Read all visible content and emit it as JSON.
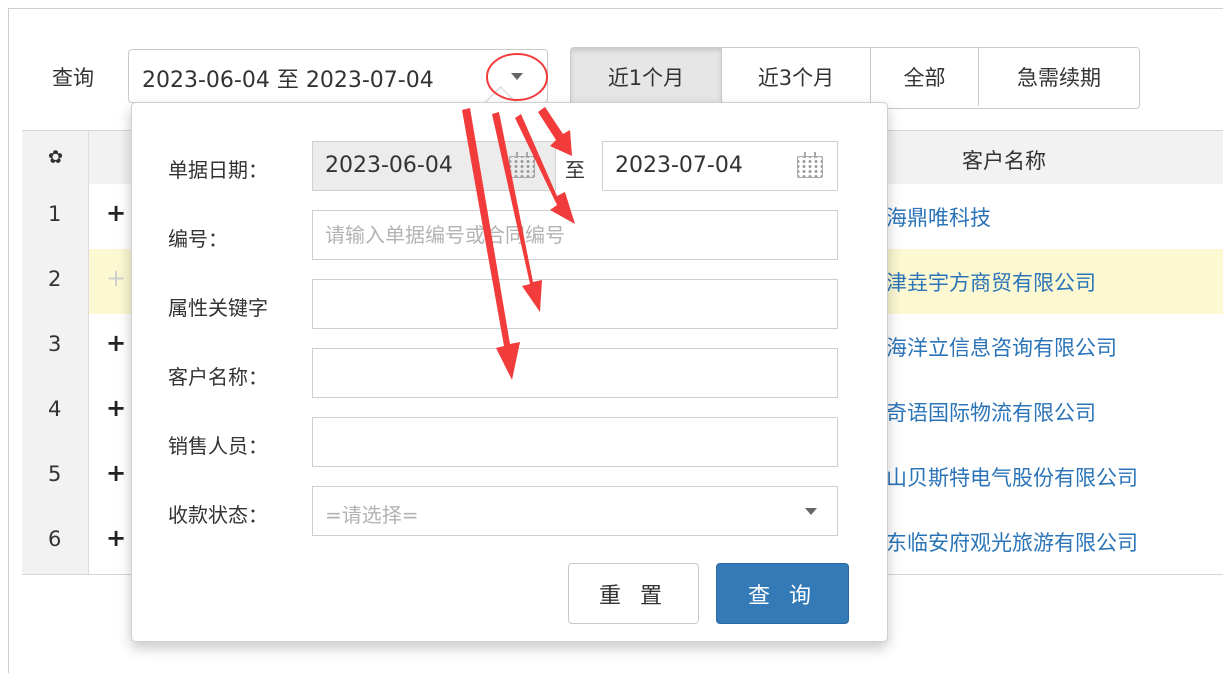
{
  "toolbar": {
    "query_label": "查询",
    "date_range": "2023-06-04 至 2023-07-04",
    "quick_ranges": [
      "近1个月",
      "近3个月",
      "全部",
      "急需续期"
    ],
    "active_quick_range": "近1个月"
  },
  "table": {
    "columns": {
      "customer": "客户名称"
    },
    "icons": {
      "settings": "gear-icon",
      "expand": "plus-icon"
    },
    "rows": [
      {
        "num": "1",
        "expand": "+",
        "customer": "海鼎唯科技"
      },
      {
        "num": "2",
        "expand": "+",
        "customer": "津垚宇方商贸有限公司"
      },
      {
        "num": "3",
        "expand": "+",
        "customer": "海洋立信息咨询有限公司"
      },
      {
        "num": "4",
        "expand": "+",
        "customer": "奇语国际物流有限公司"
      },
      {
        "num": "5",
        "expand": "+",
        "customer": "山贝斯特电气股份有限公司"
      },
      {
        "num": "6",
        "expand": "+",
        "customer": "东临安府观光旅游有限公司"
      }
    ]
  },
  "filter_popover": {
    "date_label": "单据日期：",
    "date_start": "2023-06-04",
    "date_sep": "至",
    "date_end": "2023-07-04",
    "number_label": "编号：",
    "number_placeholder": "请输入单据编号或合同编号",
    "number_value": "",
    "keyword_label": "属性关键字",
    "keyword_value": "",
    "customer_label": "客户名称：",
    "customer_value": "",
    "sales_label": "销售人员：",
    "sales_value": "",
    "status_label": "收款状态：",
    "status_selected": "=请选择=",
    "reset_label": "重 置",
    "search_label": "查 询"
  },
  "colors": {
    "primary": "#337ab7",
    "link": "#2b74b8",
    "highlight_row": "#fbf8d2",
    "annotation": "#f23b3b"
  }
}
